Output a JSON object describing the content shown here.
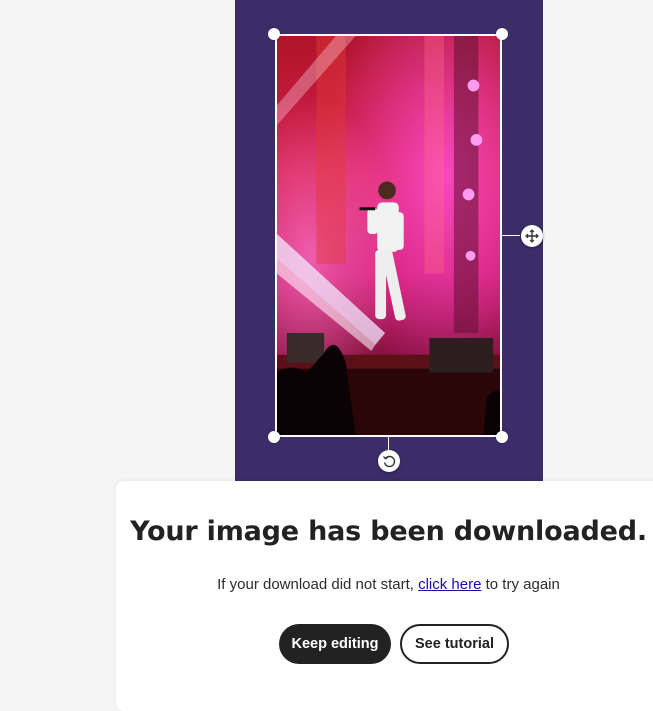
{
  "canvas": {
    "background_color": "#3c2d69",
    "photo_description_icon": "concert-photo",
    "move_handle_icon": "move-arrows-icon",
    "rotate_handle_icon": "rotate-icon"
  },
  "dialog": {
    "title": "Your image has been downloaded.",
    "message_prefix": "If your download did not start, ",
    "link_text": "click here",
    "message_suffix": " to try again",
    "primary_button": "Keep editing",
    "secondary_button": "See tutorial"
  }
}
